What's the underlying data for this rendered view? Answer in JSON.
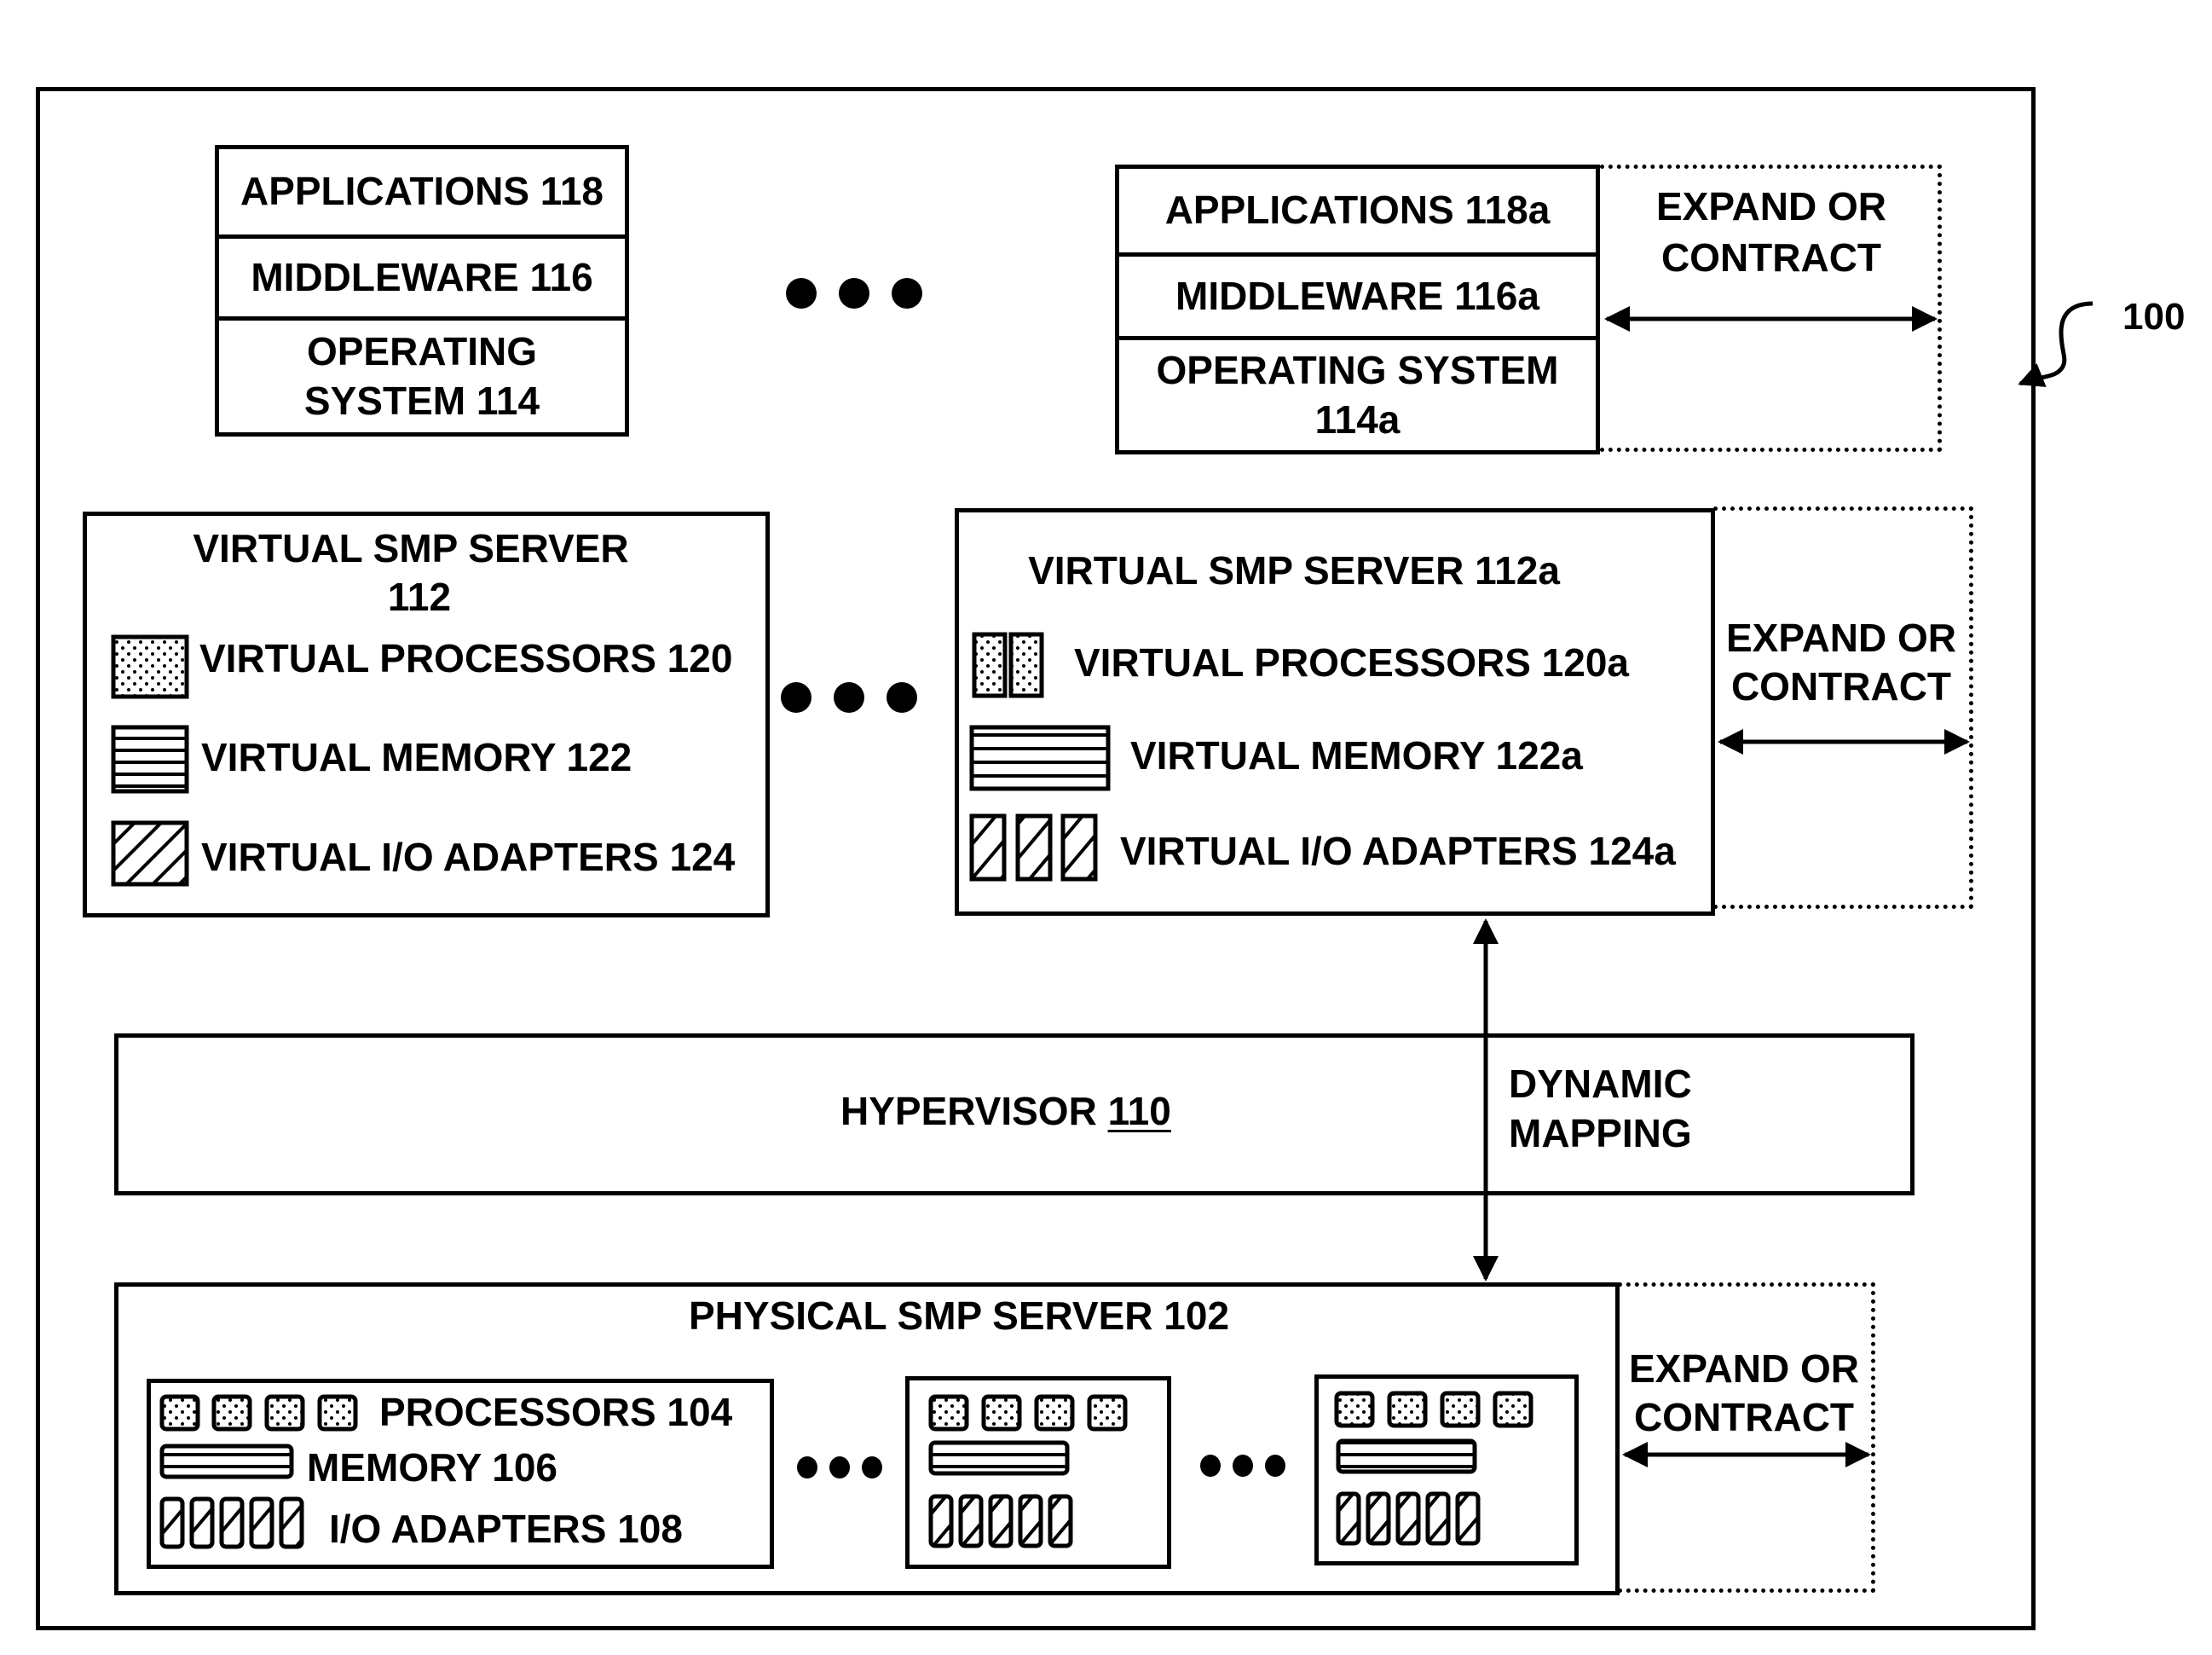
{
  "figure_ref": "100",
  "stacks": [
    {
      "applications": "APPLICATIONS 118",
      "middleware": "MIDDLEWARE 116",
      "os_line1": "OPERATING",
      "os_line2": "SYSTEM 114"
    },
    {
      "applications": "APPLICATIONS 118a",
      "middleware": "MIDDLEWARE 116a",
      "os_line1": "OPERATING SYSTEM",
      "os_line2": "114a",
      "expand_line1": "EXPAND OR",
      "expand_line2": "CONTRACT"
    }
  ],
  "virtual_servers": [
    {
      "title_line1": "VIRTUAL SMP SERVER",
      "title_line2": "112",
      "processors": "VIRTUAL PROCESSORS 120",
      "memory": "VIRTUAL MEMORY 122",
      "io": "VIRTUAL I/O ADAPTERS 124"
    },
    {
      "title": "VIRTUAL SMP SERVER 112a",
      "processors": "VIRTUAL PROCESSORS 120a",
      "memory": "VIRTUAL MEMORY 122a",
      "io": "VIRTUAL I/O ADAPTERS 124a",
      "expand_line1": "EXPAND OR",
      "expand_line2": "CONTRACT"
    }
  ],
  "hypervisor": {
    "label": "HYPERVISOR ",
    "ref": "110",
    "mapping_line1": "DYNAMIC",
    "mapping_line2": "MAPPING"
  },
  "physical_server": {
    "title": "PHYSICAL SMP SERVER 102",
    "processors": "PROCESSORS 104",
    "memory": "MEMORY 106",
    "io": "I/O ADAPTERS 108",
    "expand_line1": "EXPAND OR",
    "expand_line2": "CONTRACT"
  }
}
